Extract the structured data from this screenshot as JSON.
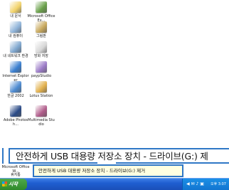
{
  "desktop": {
    "icons": [
      {
        "label": "내 문서",
        "color": "#f2d36a"
      },
      {
        "label": "Microsoft Office Ex...",
        "color": "#6aa04a"
      },
      {
        "label": "내 컴퓨터",
        "color": "#8fb4d9"
      },
      {
        "label": "그림판",
        "color": "#c8a85c"
      },
      {
        "label": "내 네트워크 환경",
        "color": "#7fa7cf"
      },
      {
        "label": "방화 저장",
        "color": "#d8d8d8"
      },
      {
        "label": "Internet Explorer",
        "color": "#3a7fd0"
      },
      {
        "label": "paypStudio",
        "color": "#9b7bc7"
      },
      {
        "label": "한글 2002",
        "color": "#4d8bd1"
      },
      {
        "label": "Lotus Station",
        "color": "#e2b04c"
      },
      {
        "label": "Adobe Photosh...",
        "color": "#2a4a86"
      },
      {
        "label": "Multimedia Studio",
        "color": "#b05c8a"
      }
    ],
    "lower_icons": [
      {
        "label": "Microsoft Office W...",
        "color": "#3c6fbf"
      },
      {
        "label": "휴지통",
        "color": "#9aa7b3"
      }
    ]
  },
  "callout": {
    "text": "안전하게 USB 대용량 저장소 장치 - 드라이브(G:) 제"
  },
  "tooltip": {
    "text": "안전하게 USB 대용량 저장소 장치 - 드라이브(G:) 제거"
  },
  "taskbar": {
    "start_label": "시작",
    "tray_icons": "◀ ✉ ♪ ▣",
    "time": "오후 3:07"
  }
}
